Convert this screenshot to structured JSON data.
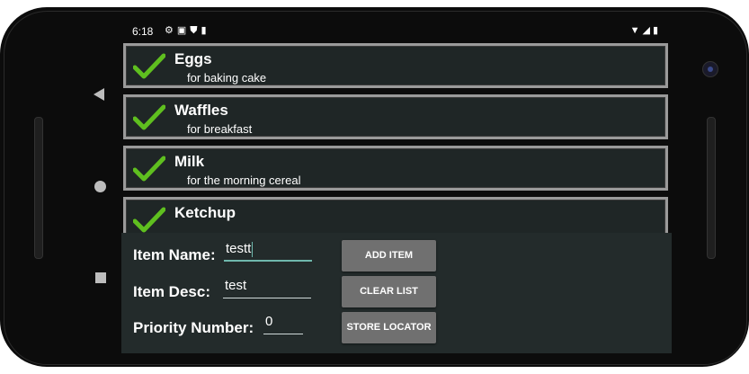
{
  "status_bar": {
    "time": "6:18",
    "icons": [
      "gear-icon",
      "a-icon",
      "shield-icon",
      "sd-card-icon"
    ],
    "right_icons": [
      "wifi-icon",
      "signal-icon",
      "battery-icon"
    ]
  },
  "items": [
    {
      "name": "Eggs",
      "desc": "for baking cake"
    },
    {
      "name": "Waffles",
      "desc": "for breakfast"
    },
    {
      "name": "Milk",
      "desc": "for the morning cereal"
    },
    {
      "name": "Ketchup",
      "desc": ""
    }
  ],
  "form": {
    "item_name_label": "Item Name:",
    "item_name_value": "testt",
    "item_desc_label": "Item Desc:",
    "item_desc_value": "test",
    "priority_label": "Priority Number:",
    "priority_value": "0"
  },
  "buttons": {
    "add": "ADD ITEM",
    "clear": "CLEAR LIST",
    "store_locator": "STORE LOCATOR"
  },
  "colors": {
    "check": "#5fbf1f",
    "background": "#232b2b",
    "button": "#707070",
    "focus_underline": "#6fb8ad"
  }
}
